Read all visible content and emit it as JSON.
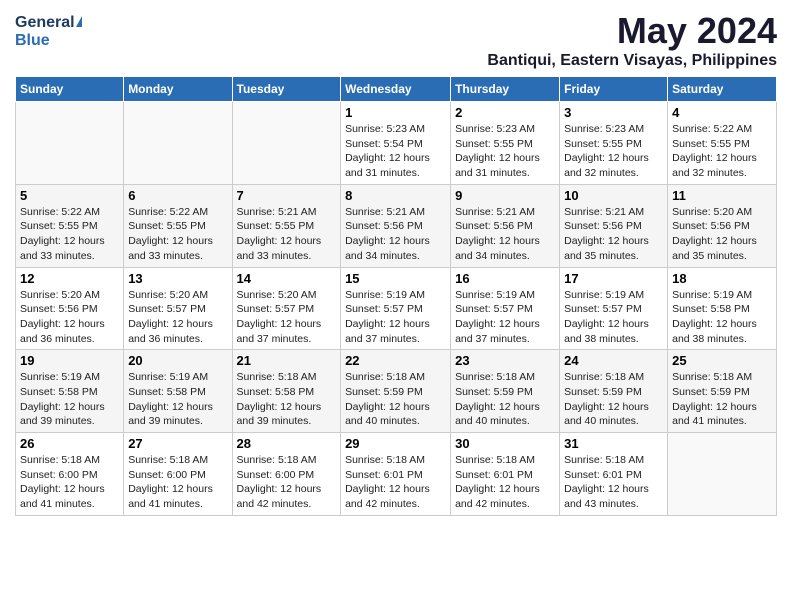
{
  "header": {
    "logo_general": "General",
    "logo_blue": "Blue",
    "title": "May 2024",
    "subtitle": "Bantiqui, Eastern Visayas, Philippines"
  },
  "days_of_week": [
    "Sunday",
    "Monday",
    "Tuesday",
    "Wednesday",
    "Thursday",
    "Friday",
    "Saturday"
  ],
  "weeks": [
    {
      "row_bg": "white",
      "cells": [
        {
          "day": "",
          "info": ""
        },
        {
          "day": "",
          "info": ""
        },
        {
          "day": "",
          "info": ""
        },
        {
          "day": "1",
          "info": "Sunrise: 5:23 AM\nSunset: 5:54 PM\nDaylight: 12 hours\nand 31 minutes."
        },
        {
          "day": "2",
          "info": "Sunrise: 5:23 AM\nSunset: 5:55 PM\nDaylight: 12 hours\nand 31 minutes."
        },
        {
          "day": "3",
          "info": "Sunrise: 5:23 AM\nSunset: 5:55 PM\nDaylight: 12 hours\nand 32 minutes."
        },
        {
          "day": "4",
          "info": "Sunrise: 5:22 AM\nSunset: 5:55 PM\nDaylight: 12 hours\nand 32 minutes."
        }
      ]
    },
    {
      "row_bg": "light",
      "cells": [
        {
          "day": "5",
          "info": "Sunrise: 5:22 AM\nSunset: 5:55 PM\nDaylight: 12 hours\nand 33 minutes."
        },
        {
          "day": "6",
          "info": "Sunrise: 5:22 AM\nSunset: 5:55 PM\nDaylight: 12 hours\nand 33 minutes."
        },
        {
          "day": "7",
          "info": "Sunrise: 5:21 AM\nSunset: 5:55 PM\nDaylight: 12 hours\nand 33 minutes."
        },
        {
          "day": "8",
          "info": "Sunrise: 5:21 AM\nSunset: 5:56 PM\nDaylight: 12 hours\nand 34 minutes."
        },
        {
          "day": "9",
          "info": "Sunrise: 5:21 AM\nSunset: 5:56 PM\nDaylight: 12 hours\nand 34 minutes."
        },
        {
          "day": "10",
          "info": "Sunrise: 5:21 AM\nSunset: 5:56 PM\nDaylight: 12 hours\nand 35 minutes."
        },
        {
          "day": "11",
          "info": "Sunrise: 5:20 AM\nSunset: 5:56 PM\nDaylight: 12 hours\nand 35 minutes."
        }
      ]
    },
    {
      "row_bg": "white",
      "cells": [
        {
          "day": "12",
          "info": "Sunrise: 5:20 AM\nSunset: 5:56 PM\nDaylight: 12 hours\nand 36 minutes."
        },
        {
          "day": "13",
          "info": "Sunrise: 5:20 AM\nSunset: 5:57 PM\nDaylight: 12 hours\nand 36 minutes."
        },
        {
          "day": "14",
          "info": "Sunrise: 5:20 AM\nSunset: 5:57 PM\nDaylight: 12 hours\nand 37 minutes."
        },
        {
          "day": "15",
          "info": "Sunrise: 5:19 AM\nSunset: 5:57 PM\nDaylight: 12 hours\nand 37 minutes."
        },
        {
          "day": "16",
          "info": "Sunrise: 5:19 AM\nSunset: 5:57 PM\nDaylight: 12 hours\nand 37 minutes."
        },
        {
          "day": "17",
          "info": "Sunrise: 5:19 AM\nSunset: 5:57 PM\nDaylight: 12 hours\nand 38 minutes."
        },
        {
          "day": "18",
          "info": "Sunrise: 5:19 AM\nSunset: 5:58 PM\nDaylight: 12 hours\nand 38 minutes."
        }
      ]
    },
    {
      "row_bg": "light",
      "cells": [
        {
          "day": "19",
          "info": "Sunrise: 5:19 AM\nSunset: 5:58 PM\nDaylight: 12 hours\nand 39 minutes."
        },
        {
          "day": "20",
          "info": "Sunrise: 5:19 AM\nSunset: 5:58 PM\nDaylight: 12 hours\nand 39 minutes."
        },
        {
          "day": "21",
          "info": "Sunrise: 5:18 AM\nSunset: 5:58 PM\nDaylight: 12 hours\nand 39 minutes."
        },
        {
          "day": "22",
          "info": "Sunrise: 5:18 AM\nSunset: 5:59 PM\nDaylight: 12 hours\nand 40 minutes."
        },
        {
          "day": "23",
          "info": "Sunrise: 5:18 AM\nSunset: 5:59 PM\nDaylight: 12 hours\nand 40 minutes."
        },
        {
          "day": "24",
          "info": "Sunrise: 5:18 AM\nSunset: 5:59 PM\nDaylight: 12 hours\nand 40 minutes."
        },
        {
          "day": "25",
          "info": "Sunrise: 5:18 AM\nSunset: 5:59 PM\nDaylight: 12 hours\nand 41 minutes."
        }
      ]
    },
    {
      "row_bg": "white",
      "cells": [
        {
          "day": "26",
          "info": "Sunrise: 5:18 AM\nSunset: 6:00 PM\nDaylight: 12 hours\nand 41 minutes."
        },
        {
          "day": "27",
          "info": "Sunrise: 5:18 AM\nSunset: 6:00 PM\nDaylight: 12 hours\nand 41 minutes."
        },
        {
          "day": "28",
          "info": "Sunrise: 5:18 AM\nSunset: 6:00 PM\nDaylight: 12 hours\nand 42 minutes."
        },
        {
          "day": "29",
          "info": "Sunrise: 5:18 AM\nSunset: 6:01 PM\nDaylight: 12 hours\nand 42 minutes."
        },
        {
          "day": "30",
          "info": "Sunrise: 5:18 AM\nSunset: 6:01 PM\nDaylight: 12 hours\nand 42 minutes."
        },
        {
          "day": "31",
          "info": "Sunrise: 5:18 AM\nSunset: 6:01 PM\nDaylight: 12 hours\nand 43 minutes."
        },
        {
          "day": "",
          "info": ""
        }
      ]
    }
  ]
}
